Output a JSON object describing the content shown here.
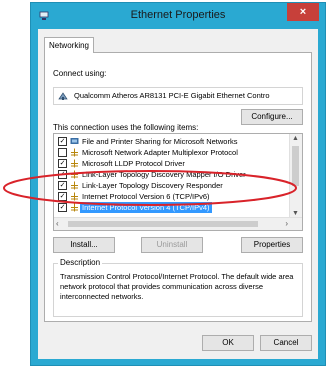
{
  "window": {
    "title": "Ethernet Properties",
    "close_label": "×"
  },
  "tabs": [
    {
      "label": "Networking"
    }
  ],
  "connect_using": {
    "label": "Connect using:",
    "adapter": "Qualcomm Atheros AR8131 PCI-E Gigabit Ethernet Contro"
  },
  "buttons": {
    "configure": "Configure...",
    "install": "Install...",
    "uninstall": "Uninstall",
    "properties": "Properties",
    "ok": "OK",
    "cancel": "Cancel"
  },
  "items_label": "This connection uses the following items:",
  "items": [
    {
      "label": "File and Printer Sharing for Microsoft Networks",
      "checked": true,
      "icon": "network-service-icon"
    },
    {
      "label": "Microsoft Network Adapter Multiplexor Protocol",
      "checked": false,
      "icon": "protocol-icon"
    },
    {
      "label": "Microsoft LLDP Protocol Driver",
      "checked": true,
      "icon": "protocol-icon"
    },
    {
      "label": "Link-Layer Topology Discovery Mapper I/O Driver",
      "checked": true,
      "icon": "protocol-icon"
    },
    {
      "label": "Link-Layer Topology Discovery Responder",
      "checked": true,
      "icon": "protocol-icon"
    },
    {
      "label": "Internet Protocol Version 6 (TCP/IPv6)",
      "checked": true,
      "icon": "protocol-icon"
    },
    {
      "label": "Internet Protocol Version 4 (TCP/IPv4)",
      "checked": true,
      "icon": "protocol-icon",
      "selected": true
    }
  ],
  "description": {
    "legend": "Description",
    "text": "Transmission Control Protocol/Internet Protocol. The default wide area network protocol that provides communication across diverse interconnected networks."
  },
  "colors": {
    "title_bar": "#2aa9d2",
    "close_button": "#c7403a",
    "selection": "#3399ff",
    "annotation": "#d9232a"
  }
}
